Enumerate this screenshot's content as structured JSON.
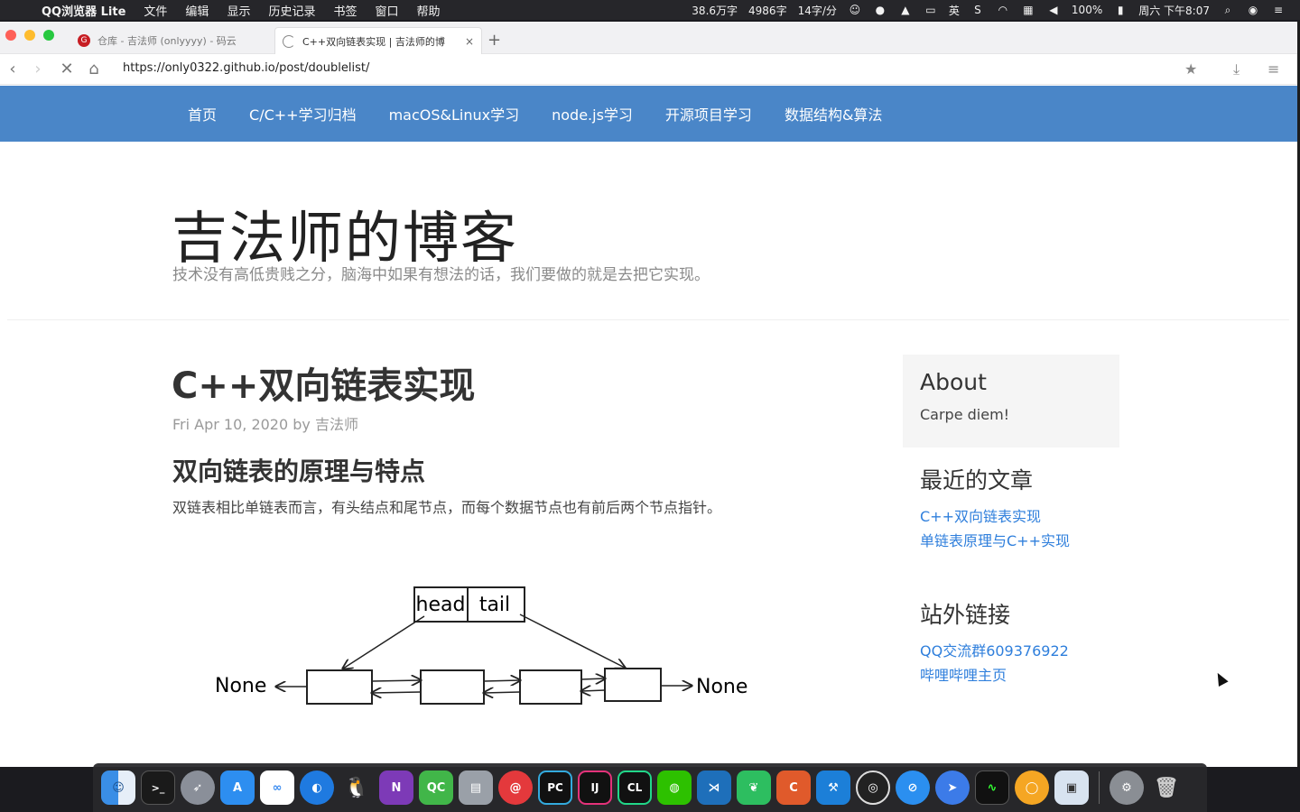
{
  "menubar": {
    "app_name": "QQ浏览器 Lite",
    "menus": [
      "文件",
      "编辑",
      "显示",
      "历史记录",
      "书签",
      "窗口",
      "帮助"
    ],
    "status": {
      "word_count_total": "38.6万字",
      "word_count_today": "4986字",
      "typing_speed": "14字/分",
      "input_method": "英",
      "battery": "100%",
      "clock": "周六 下午8:07"
    }
  },
  "browser": {
    "tabs": [
      {
        "title": "仓库 - 吉法师 (onlyyyy) - 码云",
        "active": false,
        "favicon": "gitee-icon"
      },
      {
        "title": "C++双向链表实现 | 吉法师的博",
        "active": true,
        "favicon": "loading-icon"
      }
    ],
    "url": "https://only0322.github.io/post/doublelist/"
  },
  "site": {
    "nav": [
      "首页",
      "C/C++学习归档",
      "macOS&Linux学习",
      "node.js学习",
      "开源项目学习",
      "数据结构&算法"
    ],
    "title": "吉法师的博客",
    "subtitle": "技术没有高低贵贱之分，脑海中如果有想法的话，我们要做的就是去把它实现。",
    "accent_color": "#4a86c8",
    "link_color": "#2f7fdc"
  },
  "post": {
    "title": "C++双向链表实现",
    "meta": "Fri Apr 10, 2020 by 吉法师",
    "section_heading": "双向链表的原理与特点",
    "paragraph": "双链表相比单链表而言，有头结点和尾节点，而每个数据节点也有前后两个节点指针。",
    "diagram": {
      "header_labels": [
        "head",
        "tail"
      ],
      "left_label": "None",
      "right_label": "None"
    }
  },
  "sidebar": {
    "about_title": "About",
    "about_text": "Carpe diem!",
    "recent_title": "最近的文章",
    "recent_posts": [
      "C++双向链表实现",
      "单链表原理与C++实现"
    ],
    "links_title": "站外链接",
    "links": [
      "QQ交流群609376922",
      "哔哩哔哩主页"
    ]
  },
  "dock": {
    "apps": [
      "finder-icon",
      "terminal-icon",
      "launchpad-icon",
      "app-store-icon",
      "baidu-netdisk-icon",
      "qq-browser-icon",
      "qq-icon",
      "onenote-icon",
      "qt-creator-icon",
      "archive-icon",
      "netease-music-icon",
      "pycharm-icon",
      "intellij-icon",
      "clion-icon",
      "wechat-icon",
      "vscode-icon",
      "evernote-icon",
      "c-ide-icon",
      "xcode-icon",
      "obs-icon",
      "safari-icon",
      "feishu-icon",
      "activity-monitor-icon",
      "vpn-icon",
      "preview-icon",
      "system-preferences-icon",
      "trash-icon"
    ]
  }
}
